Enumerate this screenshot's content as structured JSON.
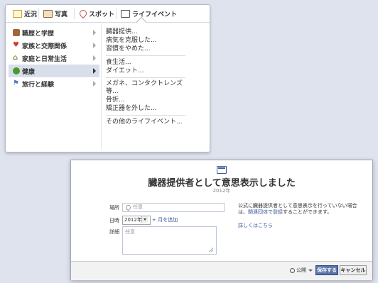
{
  "tabs": [
    {
      "label": "近況",
      "icon": "status-icon"
    },
    {
      "label": "写真",
      "icon": "photo-icon"
    },
    {
      "label": "スポット",
      "icon": "place-icon"
    },
    {
      "label": "ライフイベント",
      "icon": "life-event-icon"
    }
  ],
  "categories": [
    {
      "label": "職歴と学歴",
      "icon": "briefcase-icon",
      "color": "#a0663c"
    },
    {
      "label": "家族と交際関係",
      "icon": "heart-icon",
      "color": "#d33a3a"
    },
    {
      "label": "家庭と日常生活",
      "icon": "house-icon",
      "color": "#7a8a3a"
    },
    {
      "label": "健康",
      "icon": "health-icon",
      "color": "#4a9a2a",
      "selected": true
    },
    {
      "label": "旅行と経験",
      "icon": "flag-icon",
      "color": "#5a7ac8"
    }
  ],
  "subitems": {
    "group1": [
      "臓器提供...",
      "病気を克服した...",
      "習慣をやめた..."
    ],
    "group2": [
      "食生活...",
      "ダイエット..."
    ],
    "group3": [
      "メガネ、コンタクトレンズ等...",
      "骨折...",
      "矯正器を外した..."
    ],
    "group4": [
      "その他のライフイベント..."
    ]
  },
  "detail": {
    "title": "臓器提供者として意思表示しました",
    "year_caption": "2012年",
    "place_label": "場所",
    "place_placeholder": "任意",
    "date_label": "日時",
    "year_value": "2012年",
    "add_month": "+ 月を追加",
    "details_label": "詳細",
    "details_placeholder": "任意",
    "donor_info_text": "公式に臓器提供者として意思表示を行っていない場合は、",
    "donor_info_link": "関連団体で登録",
    "donor_info_suffix": "することができます。",
    "learn_more": "詳しくはこちら",
    "privacy_label": "公開",
    "save_label": "保存する",
    "cancel_label": "キャンセル"
  },
  "colors": {
    "accent": "#3b5998",
    "background": "#dfe3ee",
    "selected_row": "#d8dfea"
  }
}
